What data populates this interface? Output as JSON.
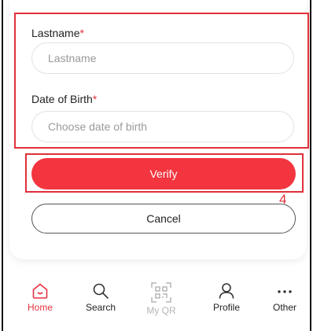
{
  "form": {
    "lastname_label": "Lastname",
    "lastname_placeholder": "Lastname",
    "dob_label": "Date of Birth",
    "dob_placeholder": "Choose date of birth",
    "required_marker": "*"
  },
  "actions": {
    "verify_label": "Verify",
    "cancel_label": "Cancel",
    "annotation_number": "4"
  },
  "nav": {
    "items": [
      {
        "label": "Home",
        "icon": "home-icon",
        "active": true
      },
      {
        "label": "Search",
        "icon": "search-icon",
        "active": false
      },
      {
        "label": "My QR",
        "icon": "qr-icon",
        "active": false,
        "disabled": true
      },
      {
        "label": "Profile",
        "icon": "profile-icon",
        "active": false
      },
      {
        "label": "Other",
        "icon": "more-icon",
        "active": false
      }
    ]
  },
  "colors": {
    "accent": "#f2353f",
    "annotation": "#e0303a",
    "disabled": "#b5b5b5"
  }
}
